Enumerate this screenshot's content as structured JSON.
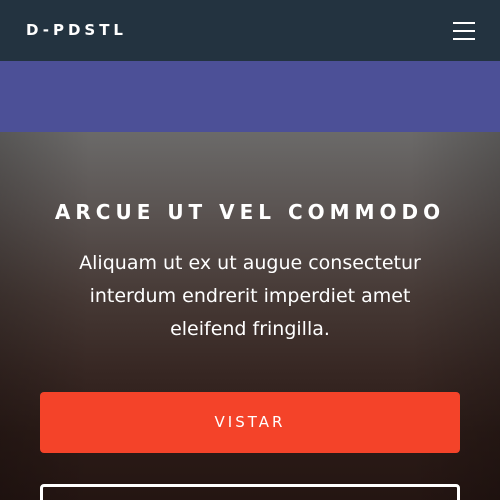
{
  "navbar": {
    "brand": "D-PDSTL",
    "menu_icon": "hamburger-menu-icon"
  },
  "hero": {
    "title": "ARCUE UT VEL COMMODO",
    "text": "Aliquam ut ex ut augue consectetur interdum endrerit imperdiet amet eleifend fringilla.",
    "primary_button": "VISTAR",
    "secondary_button": ""
  },
  "colors": {
    "navbar": "#233340",
    "band": "#4c5097",
    "cta": "#f44329"
  }
}
